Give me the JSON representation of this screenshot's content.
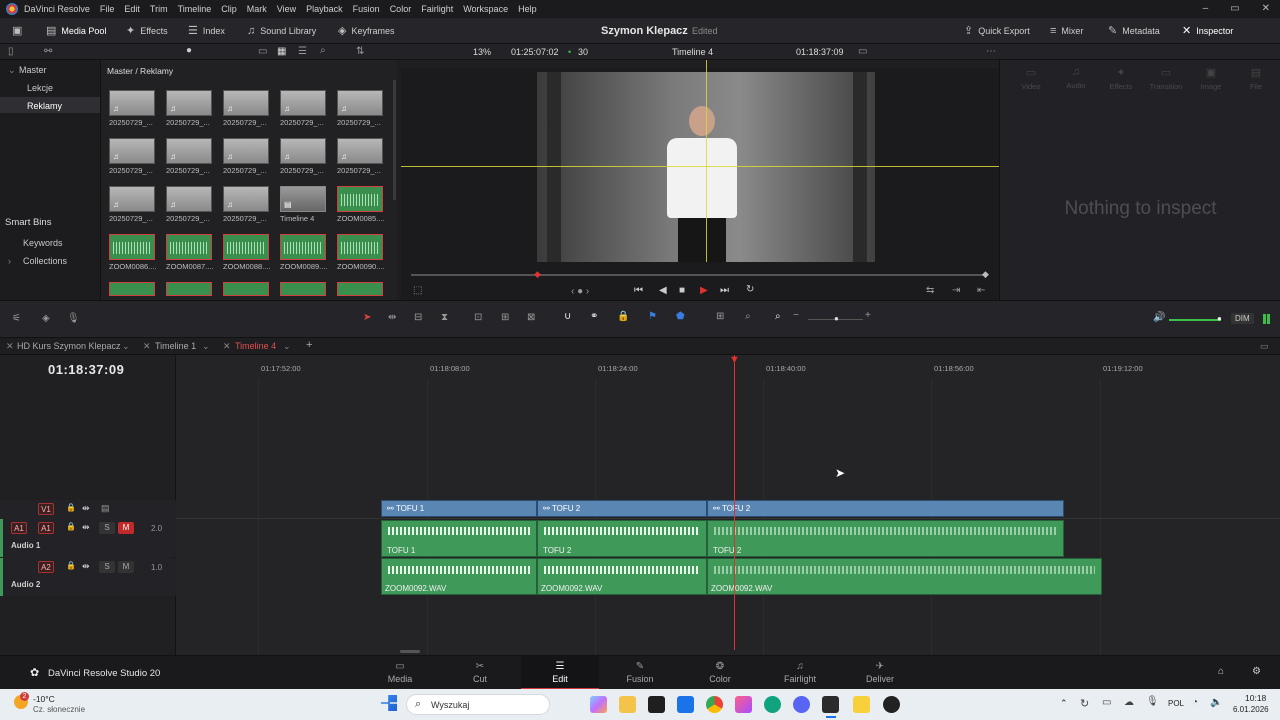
{
  "menubar": {
    "app_name": "DaVinci Resolve",
    "items": [
      "File",
      "Edit",
      "Trim",
      "Timeline",
      "Clip",
      "Mark",
      "View",
      "Playback",
      "Fusion",
      "Color",
      "Fairlight",
      "Workspace",
      "Help"
    ]
  },
  "toolbar": {
    "media_pool": "Media Pool",
    "effects": "Effects",
    "index": "Index",
    "sound_library": "Sound Library",
    "keyframes": "Keyframes",
    "project_title": "Szymon Klepacz",
    "project_status": "Edited",
    "quick_export": "Quick Export",
    "mixer": "Mixer",
    "metadata": "Metadata",
    "inspector": "Inspector"
  },
  "viewer_bar": {
    "zoom": "13%",
    "duration": "01:25:07:02",
    "fps": "30",
    "timeline_name": "Timeline 4",
    "timecode": "01:18:37:09"
  },
  "bins": {
    "master": "Master",
    "items": [
      "Lekcje",
      "Reklamy"
    ],
    "selected": "Reklamy",
    "smart_bins": "Smart Bins",
    "smart_items": [
      "Keywords",
      "Collections"
    ]
  },
  "pool": {
    "path": "Master / Reklamy",
    "clips": [
      "20250729_...",
      "20250729_...",
      "20250729_...",
      "20250729_...",
      "20250729_...",
      "20250729_...",
      "20250729_...",
      "20250729_...",
      "20250729_...",
      "20250729_...",
      "20250729_...",
      "20250729_...",
      "20250729_...",
      "Timeline 4",
      "ZOOM0085....",
      "ZOOM0086....",
      "ZOOM0087....",
      "ZOOM0088....",
      "ZOOM0089....",
      "ZOOM0090...."
    ]
  },
  "inspector_panel": {
    "tabs": [
      "Video",
      "Audio",
      "Effects",
      "Transition",
      "Image",
      "File"
    ],
    "empty_text": "Nothing to inspect"
  },
  "timeline_controls": {
    "dim": "DIM"
  },
  "timeline_tabs": [
    "HD Kurs Szymon Klepacz",
    "Timeline 1",
    "Timeline 4"
  ],
  "timeline": {
    "timecode": "01:18:37:09",
    "ruler": [
      "01:17:52:00",
      "01:18:08:00",
      "01:18:24:00",
      "01:18:40:00",
      "01:18:56:00",
      "01:19:12:00"
    ],
    "tracks": {
      "v1": "V1",
      "a1": "A1",
      "a1_name": "Audio 1",
      "a1_level": "2.0",
      "a2": "A2",
      "a2_name": "Audio 2",
      "a2_level": "1.0",
      "s": "S",
      "m": "M"
    },
    "video_clips": [
      "TOFU 1",
      "TOFU 2",
      "TOFU 2"
    ],
    "audio1_clips": [
      "TOFU 1",
      "TOFU 2",
      "TOFU 2"
    ],
    "audio2_clips": [
      "ZOOM0092.WAV",
      "ZOOM0092.WAV",
      "ZOOM0092.WAV"
    ]
  },
  "pages": {
    "brand": "DaVinci Resolve Studio 20",
    "items": [
      "Media",
      "Cut",
      "Edit",
      "Fusion",
      "Color",
      "Fairlight",
      "Deliver"
    ],
    "active": "Edit"
  },
  "taskbar": {
    "weather_temp": "-10°C",
    "weather_desc": "Cz. słonecznie",
    "weather_badge": "2",
    "search": "Wyszukaj",
    "lang": "POL",
    "time": "10:18",
    "date": "6.01.2026"
  },
  "colors": {
    "accent_red": "#d13a3a",
    "video_clip": "#5a86b4",
    "audio_clip": "#3f9a59",
    "playhead": "#e03030"
  }
}
